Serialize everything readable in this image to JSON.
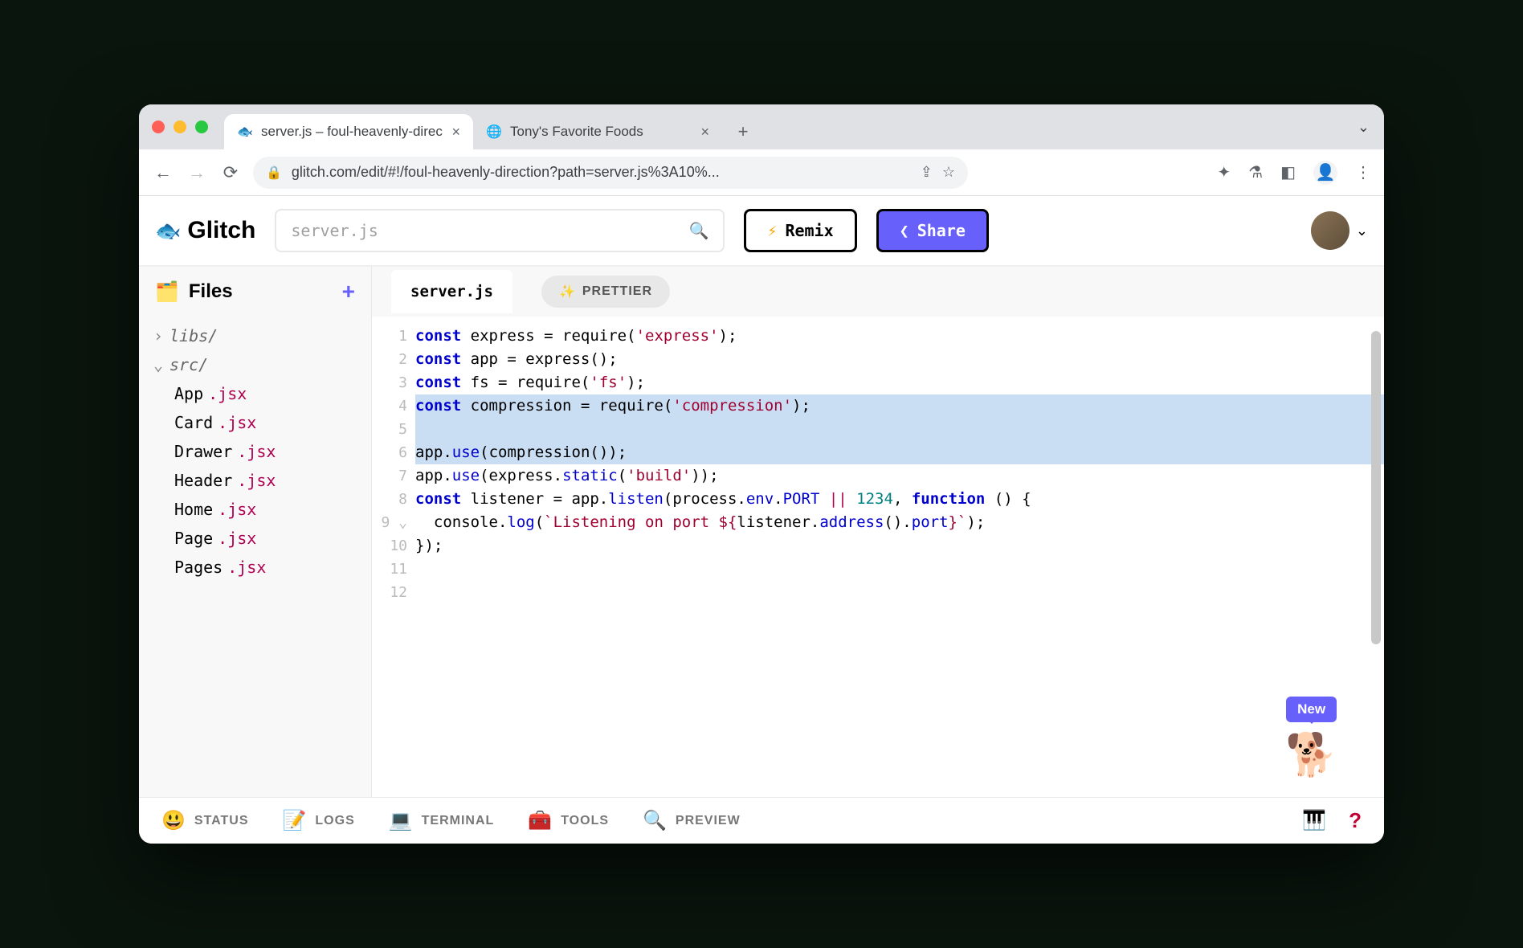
{
  "browser": {
    "tabs": [
      {
        "title": "server.js – foul-heavenly-direc",
        "active": true,
        "favicon": "🐟"
      },
      {
        "title": "Tony's Favorite Foods",
        "active": false,
        "favicon": "🌐"
      }
    ],
    "url": "glitch.com/edit/#!/foul-heavenly-direction?path=server.js%3A10%..."
  },
  "header": {
    "logo": "Glitch",
    "search_placeholder": "server.js",
    "remix_label": "Remix",
    "share_label": "Share"
  },
  "sidebar": {
    "title": "Files",
    "tree": [
      {
        "type": "folder",
        "name": "libs/",
        "open": false
      },
      {
        "type": "folder",
        "name": "src/",
        "open": true
      },
      {
        "type": "file",
        "base": "App",
        "ext": ".jsx"
      },
      {
        "type": "file",
        "base": "Card",
        "ext": ".jsx"
      },
      {
        "type": "file",
        "base": "Drawer",
        "ext": ".jsx"
      },
      {
        "type": "file",
        "base": "Header",
        "ext": ".jsx"
      },
      {
        "type": "file",
        "base": "Home",
        "ext": ".jsx"
      },
      {
        "type": "file",
        "base": "Page",
        "ext": ".jsx"
      },
      {
        "type": "file",
        "base": "Pages",
        "ext": ".jsx"
      }
    ]
  },
  "editor": {
    "active_tab": "server.js",
    "prettier_label": "PRETTIER",
    "line_numbers": [
      "1",
      "2",
      "3",
      "4",
      "5",
      "6",
      "7",
      "8",
      "9",
      "10",
      "11",
      "12"
    ],
    "code_lines": [
      {
        "hl": false,
        "tokens": [
          {
            "t": "const ",
            "c": "kw"
          },
          {
            "t": "express = ",
            "c": "fn"
          },
          {
            "t": "require",
            "c": "fn"
          },
          {
            "t": "(",
            "c": "fn"
          },
          {
            "t": "'express'",
            "c": "str"
          },
          {
            "t": ");",
            "c": "fn"
          }
        ]
      },
      {
        "hl": false,
        "tokens": [
          {
            "t": "const ",
            "c": "kw"
          },
          {
            "t": "app = ",
            "c": "fn"
          },
          {
            "t": "express",
            "c": "fn"
          },
          {
            "t": "();",
            "c": "fn"
          }
        ]
      },
      {
        "hl": false,
        "tokens": [
          {
            "t": "const ",
            "c": "kw"
          },
          {
            "t": "fs = ",
            "c": "fn"
          },
          {
            "t": "require",
            "c": "fn"
          },
          {
            "t": "(",
            "c": "fn"
          },
          {
            "t": "'fs'",
            "c": "str"
          },
          {
            "t": ");",
            "c": "fn"
          }
        ]
      },
      {
        "hl": true,
        "tokens": [
          {
            "t": "const ",
            "c": "kw"
          },
          {
            "t": "compression = ",
            "c": "fn"
          },
          {
            "t": "require",
            "c": "fn"
          },
          {
            "t": "(",
            "c": "fn"
          },
          {
            "t": "'compression'",
            "c": "str"
          },
          {
            "t": ");",
            "c": "fn"
          }
        ]
      },
      {
        "hl": true,
        "tokens": [
          {
            "t": "",
            "c": "fn"
          }
        ]
      },
      {
        "hl": true,
        "tokens": [
          {
            "t": "app",
            "c": "fn"
          },
          {
            "t": ".",
            "c": "fn"
          },
          {
            "t": "use",
            "c": "prop"
          },
          {
            "t": "(",
            "c": "fn"
          },
          {
            "t": "compression",
            "c": "fn"
          },
          {
            "t": "());",
            "c": "fn"
          }
        ]
      },
      {
        "hl": false,
        "tokens": [
          {
            "t": "app",
            "c": "fn"
          },
          {
            "t": ".",
            "c": "fn"
          },
          {
            "t": "use",
            "c": "prop"
          },
          {
            "t": "(express.",
            "c": "fn"
          },
          {
            "t": "static",
            "c": "prop"
          },
          {
            "t": "(",
            "c": "fn"
          },
          {
            "t": "'build'",
            "c": "str"
          },
          {
            "t": "));",
            "c": "fn"
          }
        ]
      },
      {
        "hl": false,
        "tokens": [
          {
            "t": "",
            "c": "fn"
          }
        ]
      },
      {
        "hl": false,
        "tokens": [
          {
            "t": "const ",
            "c": "kw"
          },
          {
            "t": "listener = app.",
            "c": "fn"
          },
          {
            "t": "listen",
            "c": "prop"
          },
          {
            "t": "(process.",
            "c": "fn"
          },
          {
            "t": "env",
            "c": "prop"
          },
          {
            "t": ".",
            "c": "fn"
          },
          {
            "t": "PORT",
            "c": "prop"
          },
          {
            "t": " ",
            "c": "fn"
          },
          {
            "t": "||",
            "c": "op"
          },
          {
            "t": " ",
            "c": "fn"
          },
          {
            "t": "1234",
            "c": "num"
          },
          {
            "t": ", ",
            "c": "fn"
          },
          {
            "t": "function ",
            "c": "kw"
          },
          {
            "t": "() {",
            "c": "fn"
          }
        ]
      },
      {
        "hl": false,
        "tokens": [
          {
            "t": "  console.",
            "c": "fn"
          },
          {
            "t": "log",
            "c": "prop"
          },
          {
            "t": "(",
            "c": "fn"
          },
          {
            "t": "`Listening on port ${",
            "c": "str"
          },
          {
            "t": "listener.",
            "c": "fn"
          },
          {
            "t": "address",
            "c": "prop"
          },
          {
            "t": "().",
            "c": "fn"
          },
          {
            "t": "port",
            "c": "prop"
          },
          {
            "t": "}`",
            "c": "str"
          },
          {
            "t": ");",
            "c": "fn"
          }
        ]
      },
      {
        "hl": false,
        "tokens": [
          {
            "t": "});",
            "c": "fn"
          }
        ]
      },
      {
        "hl": false,
        "tokens": [
          {
            "t": "",
            "c": "fn"
          }
        ]
      }
    ],
    "new_badge": "New"
  },
  "footer": {
    "items": [
      {
        "label": "STATUS",
        "icon": "😃"
      },
      {
        "label": "LOGS",
        "icon": "📝"
      },
      {
        "label": "TERMINAL",
        "icon": "💻"
      },
      {
        "label": "TOOLS",
        "icon": "🧰"
      },
      {
        "label": "PREVIEW",
        "icon": "🔍"
      }
    ]
  }
}
